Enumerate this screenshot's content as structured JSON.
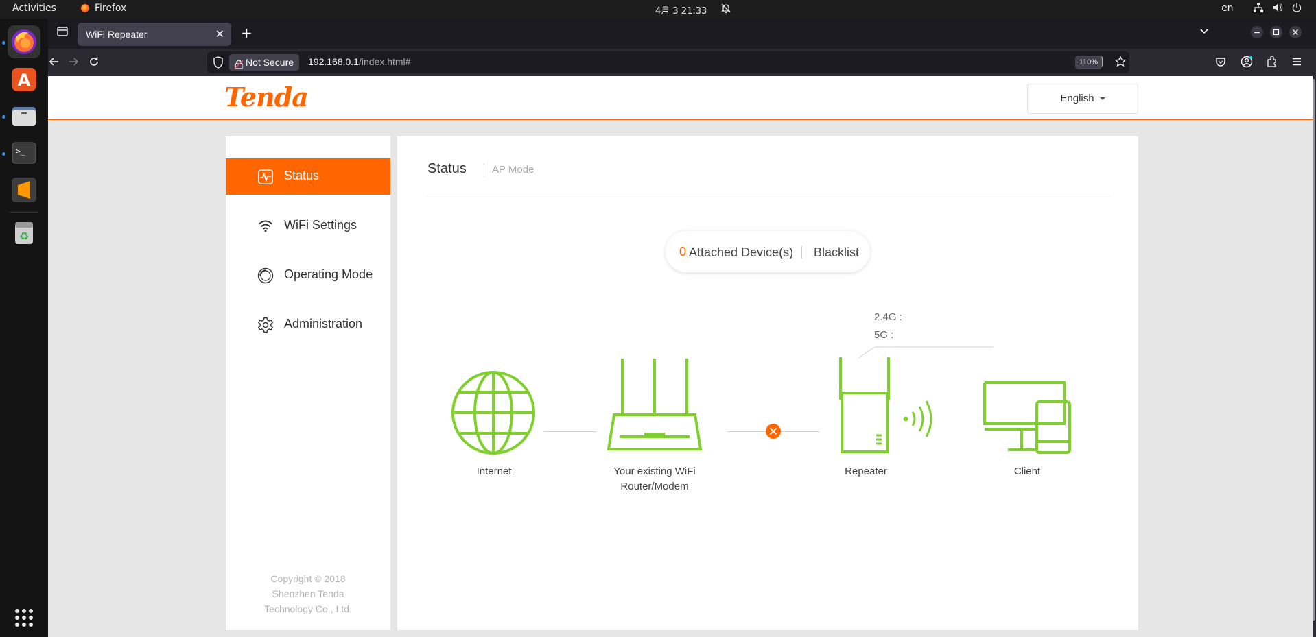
{
  "topbar": {
    "activities": "Activities",
    "app_name": "Firefox",
    "clock": "4月 3  21:33",
    "language": "en"
  },
  "dock": {
    "items": [
      "firefox-icon",
      "app-center-icon",
      "files-icon",
      "terminal-icon",
      "sublime-text-icon",
      "trash-icon",
      "show-apps-icon"
    ]
  },
  "browser": {
    "tab_title": "WiFi Repeater",
    "not_secure_label": "Not Secure",
    "url_host": "192.168.0.1",
    "url_path": "/index.html#",
    "zoom": "110%"
  },
  "router": {
    "brand": "Tenda",
    "language_selected": "English",
    "menu": [
      {
        "label": "Status",
        "icon": "pulse-monitor-icon",
        "active": true
      },
      {
        "label": "WiFi Settings",
        "icon": "wifi-icon",
        "active": false
      },
      {
        "label": "Operating Mode",
        "icon": "mode-ring-icon",
        "active": false
      },
      {
        "label": "Administration",
        "icon": "gear-icon",
        "active": false
      }
    ],
    "copyright_lines": [
      "Copyright © 2018",
      "Shenzhen Tenda",
      "Technology Co., Ltd."
    ],
    "main_title": "Status",
    "mode": "AP Mode",
    "attached_count": "0",
    "attached_label": "Attached Device(s)",
    "blacklist_label": "Blacklist",
    "band_24": "2.4G :",
    "band_5": "5G :",
    "diagram": {
      "internet": "Internet",
      "router_line1": "Your existing WiFi",
      "router_line2": "Router/Modem",
      "repeater": "Repeater",
      "client": "Client"
    },
    "colors": {
      "accent": "#ff6600",
      "diagram_green": "#7fd02c"
    }
  }
}
